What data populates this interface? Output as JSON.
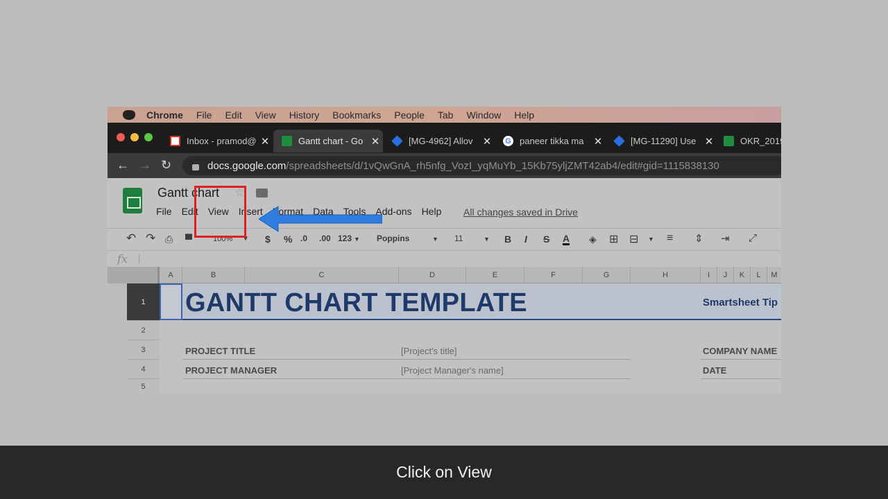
{
  "mac_menu": {
    "items": [
      "Chrome",
      "File",
      "Edit",
      "View",
      "History",
      "Bookmarks",
      "People",
      "Tab",
      "Window",
      "Help"
    ]
  },
  "browser": {
    "tabs": [
      {
        "title": "Inbox - pramod@",
        "icon": "gmail-icon"
      },
      {
        "title": "Gantt chart - Go",
        "icon": "sheets-icon",
        "active": true
      },
      {
        "title": "[MG-4962] Allov",
        "icon": "jira-icon"
      },
      {
        "title": "paneer tikka ma",
        "icon": "google-icon"
      },
      {
        "title": "[MG-11290] Use",
        "icon": "jira-icon"
      },
      {
        "title": "OKR_2019",
        "icon": "sheets-icon"
      }
    ],
    "url_host": "docs.google.com",
    "url_path": "/spreadsheets/d/1vQwGnA_rh5nfg_VozI_yqMuYb_15Kb75yljZMT42ab4/edit#gid=1115838130"
  },
  "sheets": {
    "title": "Gantt chart",
    "menu": [
      "File",
      "Edit",
      "View",
      "Insert",
      "Format",
      "Data",
      "Tools",
      "Add-ons",
      "Help"
    ],
    "saved_status": "All changes saved in Drive",
    "toolbar": {
      "zoom": "100%",
      "currency": "$",
      "percent": "%",
      "dec_less": ".0",
      "dec_more": ".00",
      "format_more": "123",
      "font": "Poppins",
      "font_size": "11",
      "bold": "B",
      "italic": "I",
      "strike": "S",
      "text_color": "A"
    },
    "fx_label": "fx",
    "columns": [
      "A",
      "B",
      "C",
      "D",
      "E",
      "F",
      "G",
      "H",
      "I",
      "J",
      "K",
      "L",
      "M"
    ],
    "rows": [
      "1",
      "2",
      "3",
      "4",
      "5"
    ],
    "cells": {
      "banner": "GANTT CHART TEMPLATE",
      "tip": "Smartsheet Tip",
      "project_title_label": "PROJECT TITLE",
      "project_title_value": "[Project's title]",
      "project_manager_label": "PROJECT MANAGER",
      "project_manager_value": "[Project Manager's name]",
      "company_label": "COMPANY NAME",
      "date_label": "DATE"
    }
  },
  "caption": "Click on View",
  "colors": {
    "highlight_box": "#e02020",
    "arrow": "#2f7de0",
    "banner_text": "#1d3a6b"
  }
}
